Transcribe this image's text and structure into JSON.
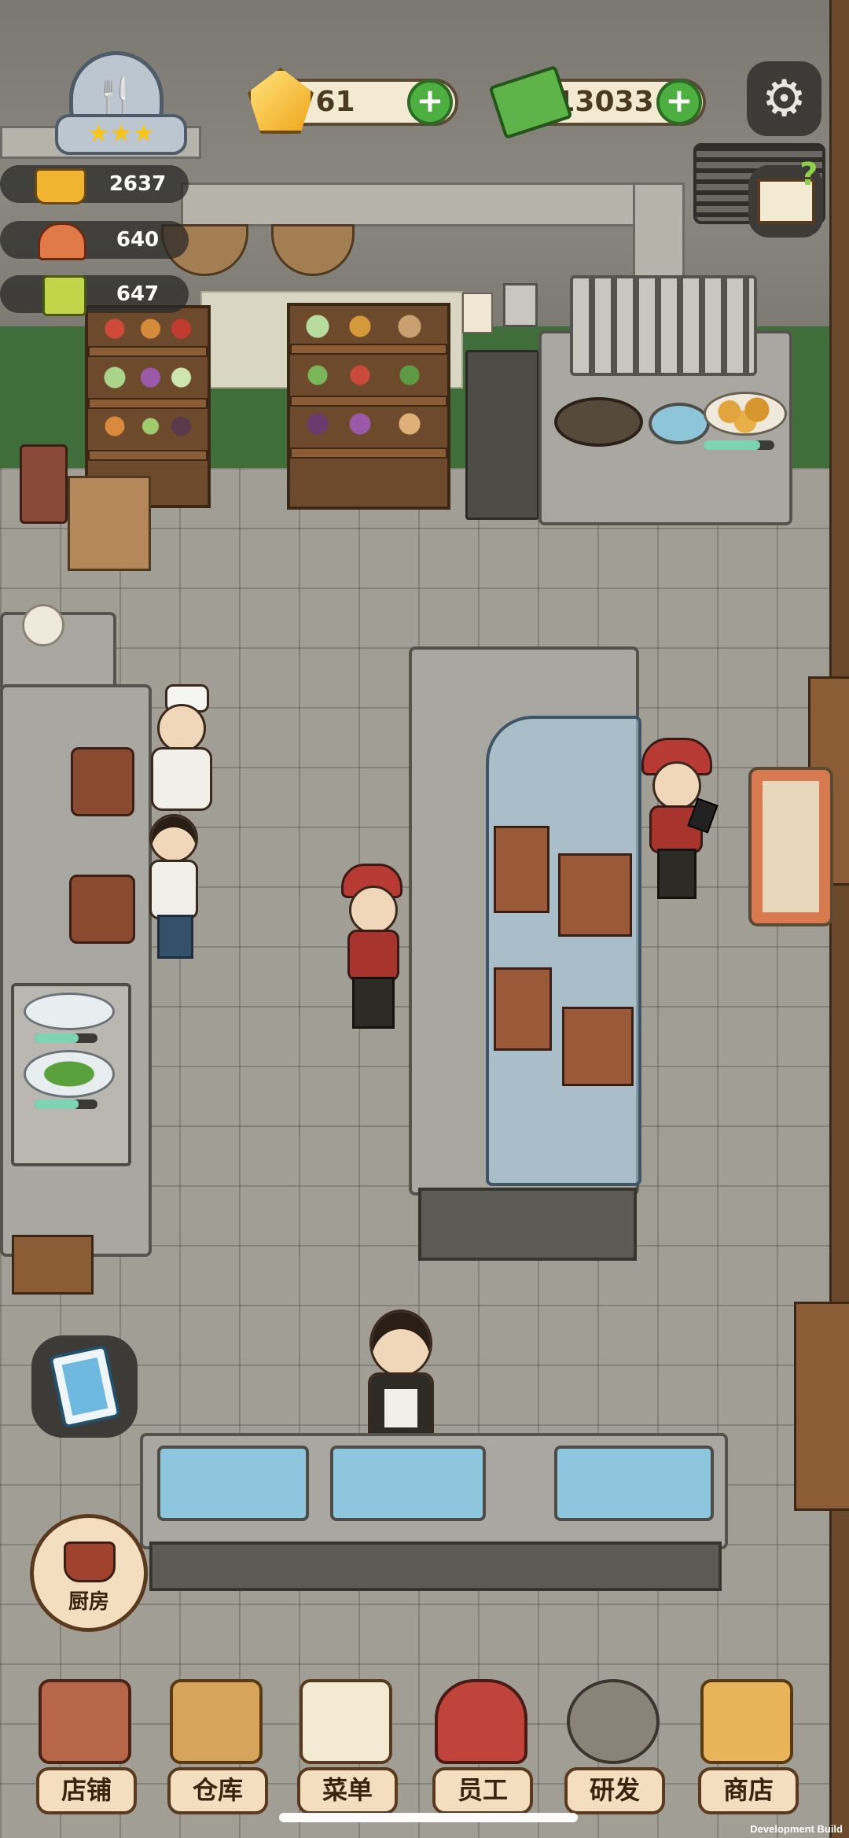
{
  "hud": {
    "gems": "61",
    "cash": "13033",
    "plus": "+",
    "stats": {
      "dishes": "2637",
      "service": "640",
      "recipes": "647"
    },
    "rating_stars": 3
  },
  "icons": {
    "settings": "gear-icon",
    "guide": "book-help-icon",
    "tasks": "clipboard-icon"
  },
  "kitchen_button": "厨房",
  "nav": [
    {
      "label": "店铺",
      "icon": "shop-icon"
    },
    {
      "label": "仓库",
      "icon": "warehouse-icon"
    },
    {
      "label": "菜单",
      "icon": "menu-icon"
    },
    {
      "label": "员工",
      "icon": "staff-icon"
    },
    {
      "label": "研发",
      "icon": "research-icon"
    },
    {
      "label": "商店",
      "icon": "store-icon"
    }
  ],
  "build_label": "Development Build",
  "colors": {
    "accent_green": "#4caf3f",
    "wall_green": "#3f6e3a"
  }
}
